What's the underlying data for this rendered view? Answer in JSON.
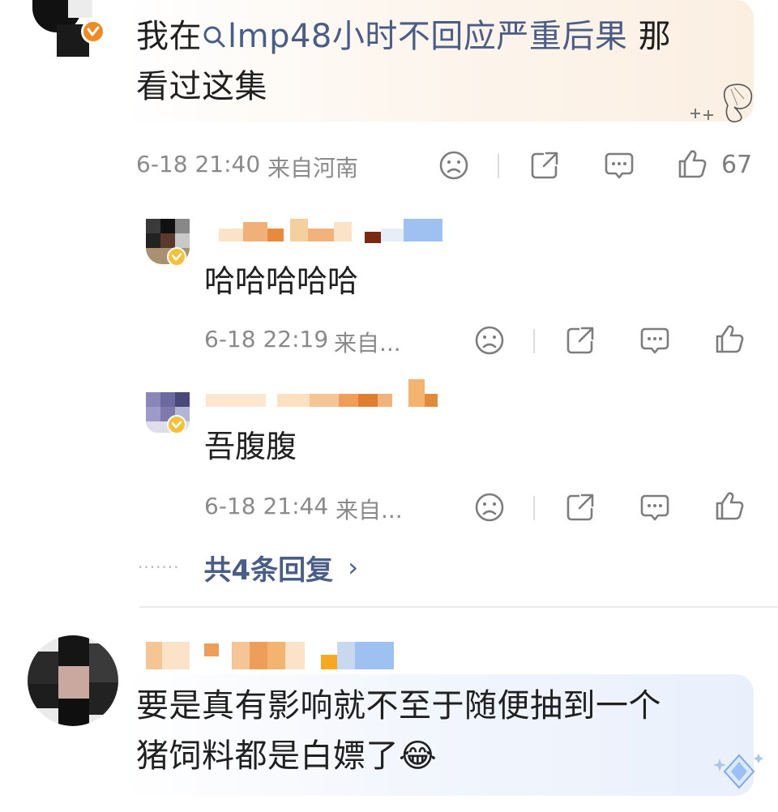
{
  "comment1": {
    "text_before": "我在",
    "link_text": "lmp48小时不回应严重后果",
    "text_after": " 那",
    "text_line2": "看过这集",
    "time": "6-18 21:40",
    "location": "来自河南",
    "like_count": "67"
  },
  "replies": [
    {
      "text": "哈哈哈哈哈",
      "time": "6-18 22:19",
      "location": "来自..."
    },
    {
      "text": "吾腹腹",
      "time": "6-18 21:44",
      "location": "来自..."
    }
  ],
  "more_replies_label": "共4条回复",
  "more_replies_chevron": "›",
  "comment2": {
    "line1": "要是真有影响就不至于随便抽到一个",
    "line2": "猪饲料都是白嫖了",
    "emoji": "😂"
  },
  "icons": {
    "dislike": "frown-face-icon",
    "share": "share-icon",
    "comment": "comment-icon",
    "like": "thumbs-up-icon",
    "verified": "verified-badge-icon",
    "search": "search-icon",
    "decoration": "butterfly-decoration-icon"
  },
  "colors": {
    "link": "#4a5d86",
    "meta": "#8a8a8a",
    "verified_orange": "#f08a24",
    "verified_yellow": "#f3c23a"
  }
}
